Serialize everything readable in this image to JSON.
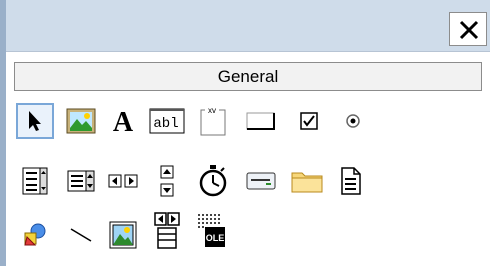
{
  "window": {
    "close_glyph": "✕"
  },
  "toolbox": {
    "group_label": "General",
    "tools": [
      {
        "name": "pointer-icon",
        "selected": true
      },
      {
        "name": "picture-box-icon"
      },
      {
        "name": "label-icon",
        "glyph": "A"
      },
      {
        "name": "textbox-icon",
        "glyph": "abl"
      },
      {
        "name": "frame-icon",
        "glyph": "xv"
      },
      {
        "name": "command-button-icon"
      },
      {
        "name": "checkbox-icon"
      },
      {
        "name": "option-button-icon"
      },
      {
        "name": "combo-box-icon"
      },
      {
        "name": "list-box-icon"
      },
      {
        "name": "hscrollbar-icon"
      },
      {
        "name": "vscrollbar-icon"
      },
      {
        "name": "timer-icon"
      },
      {
        "name": "drive-list-box-icon"
      },
      {
        "name": "dir-list-box-icon"
      },
      {
        "name": "file-list-box-icon"
      },
      {
        "name": "shape-icon"
      },
      {
        "name": "line-icon"
      },
      {
        "name": "image-icon"
      },
      {
        "name": "data-icon"
      },
      {
        "name": "ole-icon",
        "glyph": "OLE"
      }
    ]
  },
  "colors": {
    "title_bar": "#cfdcea",
    "selection": "#7aa7d8"
  }
}
